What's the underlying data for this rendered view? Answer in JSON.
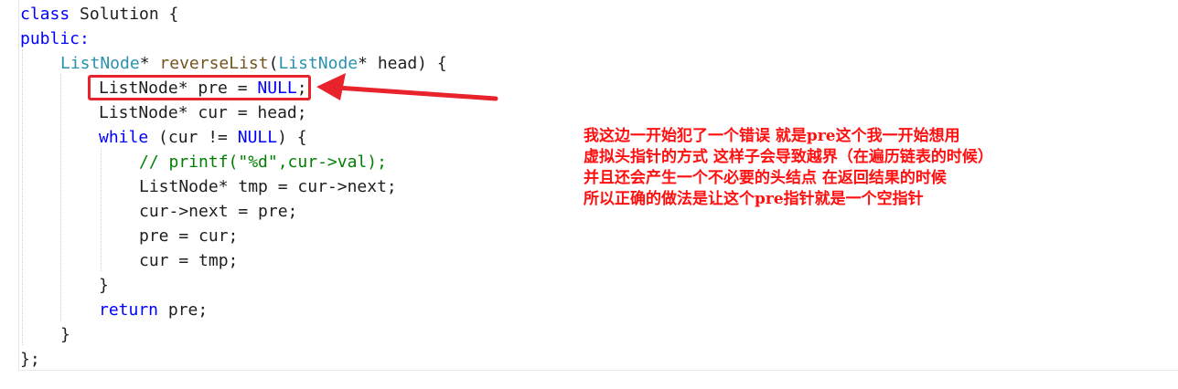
{
  "code": {
    "line1": {
      "kw": "class",
      "name": " Solution {"
    },
    "line2": {
      "kw": "public:"
    },
    "line3": {
      "type1": "ListNode",
      "a": "* ",
      "fn": "reverseList",
      "b": "(",
      "type2": "ListNode",
      "c": "* head) {"
    },
    "line4": {
      "a": "ListNode* pre = ",
      "kw": "NULL",
      "b": ";"
    },
    "line5": {
      "a": "ListNode* cur = head;"
    },
    "line6": {
      "kw": "while",
      "a": " (cur != ",
      "kw2": "NULL",
      "b": ") {"
    },
    "line7": {
      "cm": "// printf(\"%d\",cur->val);"
    },
    "line8": {
      "a": "ListNode* tmp = cur->next;"
    },
    "line9": {
      "a": "cur->next = pre;"
    },
    "line10": {
      "a": "pre = cur;"
    },
    "line11": {
      "a": "cur = tmp;"
    },
    "line12": {
      "a": "}"
    },
    "line13": {
      "kw": "return",
      "a": " pre;"
    },
    "line14": {
      "a": "}"
    },
    "line15": {
      "a": "};"
    }
  },
  "annotation": {
    "line1": "我这边一开始犯了一个错误 就是pre这个我一开始想用",
    "line2": "虚拟头指针的方式 这样子会导致越界（在遍历链表的时候）",
    "line3": "并且还会产生一个不必要的头结点 在返回结果的时候",
    "line4": "所以正确的做法是让这个pre指针就是一个空指针"
  },
  "colors": {
    "keyword": "#0000ff",
    "type": "#2b91af",
    "function": "#74531f",
    "comment": "#008000",
    "annotation": "#ff1010",
    "highlight_box": "#e8232b"
  }
}
